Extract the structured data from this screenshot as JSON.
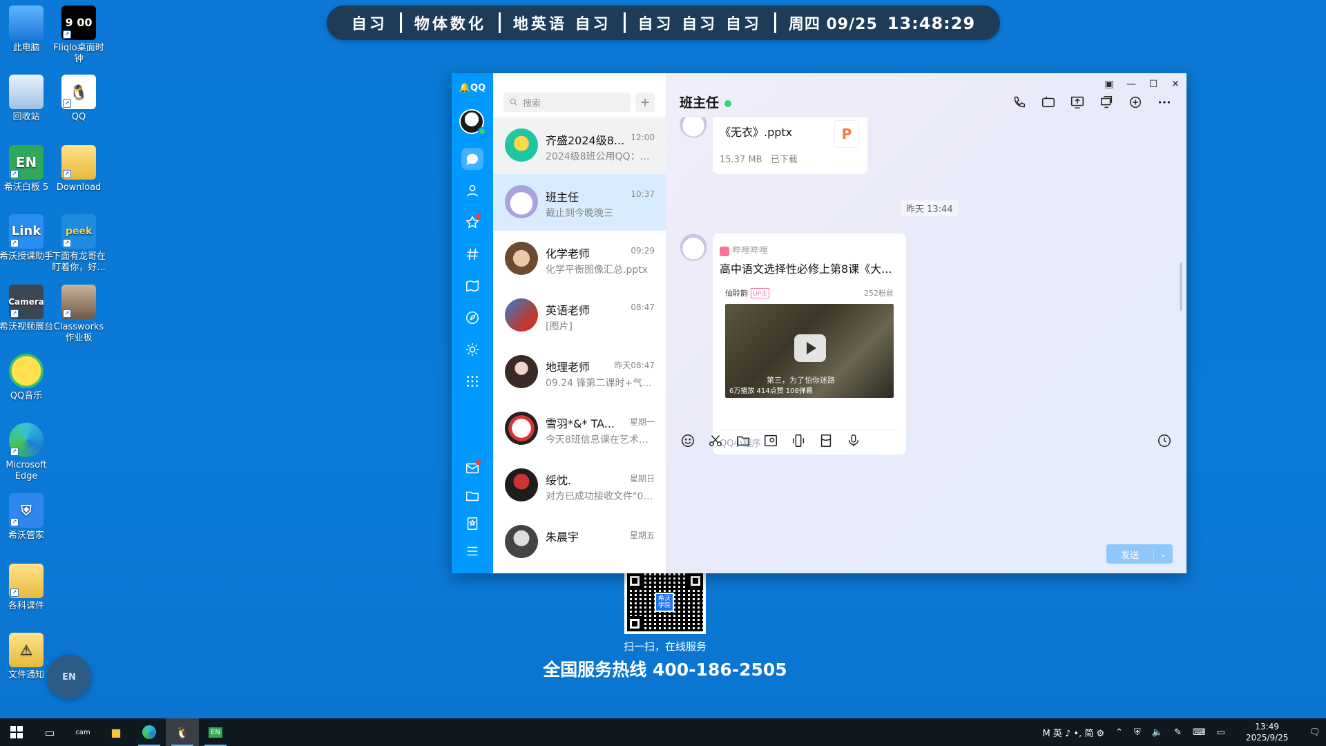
{
  "schedule": {
    "seg1": "自习",
    "seg2": "物体数化",
    "seg3": "地英语 自习",
    "seg4": "自习 自习 自习",
    "date": "周四 09/25",
    "clock": "13:48:29"
  },
  "desktop": {
    "icons": [
      {
        "label": "此电脑",
        "icon": "computer-icon"
      },
      {
        "label": "Fliqlo桌面时钟",
        "icon": "clock-icon"
      },
      {
        "label": "回收站",
        "icon": "recycle-bin-icon"
      },
      {
        "label": "QQ",
        "icon": "qq-icon"
      },
      {
        "label": "希沃白板 5",
        "icon": "seewo-whiteboard-icon"
      },
      {
        "label": "Download",
        "icon": "folder-icon"
      },
      {
        "label": "希沃授课助手",
        "icon": "link-icon"
      },
      {
        "label": "下面有龙哥在盯着你，好...",
        "icon": "image-icon"
      },
      {
        "label": "希沃视频展台",
        "icon": "camera-icon"
      },
      {
        "label": "Classworks作业板",
        "icon": "classworks-icon"
      },
      {
        "label": "QQ音乐",
        "icon": "music-icon"
      },
      {
        "label": "Microsoft Edge",
        "icon": "edge-icon"
      },
      {
        "label": "希沃管家",
        "icon": "shield-icon"
      },
      {
        "label": "各科课件",
        "icon": "folder-icon"
      },
      {
        "label": "文件通知",
        "icon": "warning-folder-icon"
      }
    ],
    "floating_btn": "EN",
    "qr_logo": "希沃学院",
    "qr_caption": "扫一扫，在线服务",
    "hotline": "全国服务热线 400-186-2505"
  },
  "qq": {
    "brand": "QQ",
    "search_placeholder": "搜索",
    "conversations": [
      {
        "name": "齐盛2024级8...",
        "time": "12:00",
        "preview": "2024级8班公用QQ：作..."
      },
      {
        "name": "班主任",
        "time": "10:37",
        "preview": "截止到今晚晚三"
      },
      {
        "name": "化学老师",
        "time": "09:29",
        "preview": "化学平衡图像汇总.pptx"
      },
      {
        "name": "英语老师",
        "time": "08:47",
        "preview": "[图片]"
      },
      {
        "name": "地理老师",
        "time": "昨天08:47",
        "preview": "09.24 锋第二课时+气..."
      },
      {
        "name": "雪羽*&* TA...",
        "time": "星期一",
        "preview": "今天8班信息课在艺术楼..."
      },
      {
        "name": "绥忱.",
        "time": "星期日",
        "preview": "对方已成功接收文件\"09..."
      },
      {
        "name": "朱晨宇",
        "time": "星期五",
        "preview": ""
      }
    ],
    "chat": {
      "title": "班主任",
      "file_name": "《无衣》.pptx",
      "file_size": "15.37 MB",
      "file_status": "已下载",
      "ppt_glyph": "P",
      "timestamp": "昨天 13:44",
      "card_source": "哔哩哔哩",
      "card_title": "高中语文选择性必修上第8课《大...",
      "uploader": "仙聆韵",
      "up_badge": "UP主",
      "fans": "252粉丝",
      "video_stats": "6万播放 414点赞 108弹幕",
      "video_sub": "第三，为了怕你迷路",
      "mini_program": "QQ小程序",
      "send": "发送"
    }
  },
  "taskbar": {
    "tray_text": "M 英 ♪ •, 简 ⚙",
    "time": "13:49",
    "date": "2025/9/25"
  }
}
